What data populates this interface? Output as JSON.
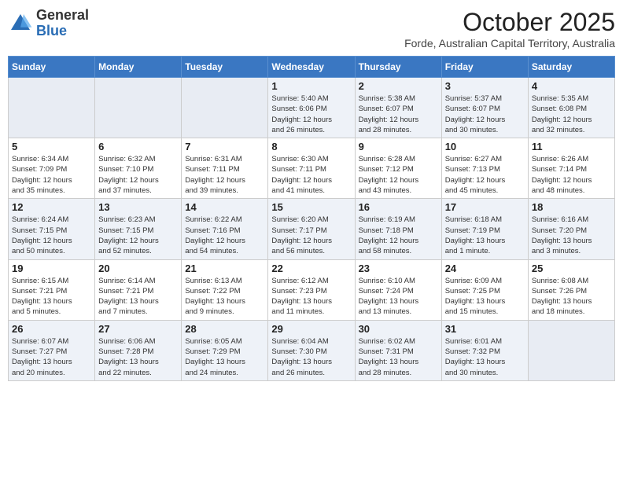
{
  "header": {
    "logo_general": "General",
    "logo_blue": "Blue",
    "month_year": "October 2025",
    "location": "Forde, Australian Capital Territory, Australia"
  },
  "days_of_week": [
    "Sunday",
    "Monday",
    "Tuesday",
    "Wednesday",
    "Thursday",
    "Friday",
    "Saturday"
  ],
  "weeks": [
    [
      {
        "day": "",
        "info": ""
      },
      {
        "day": "",
        "info": ""
      },
      {
        "day": "",
        "info": ""
      },
      {
        "day": "1",
        "info": "Sunrise: 5:40 AM\nSunset: 6:06 PM\nDaylight: 12 hours\nand 26 minutes."
      },
      {
        "day": "2",
        "info": "Sunrise: 5:38 AM\nSunset: 6:07 PM\nDaylight: 12 hours\nand 28 minutes."
      },
      {
        "day": "3",
        "info": "Sunrise: 5:37 AM\nSunset: 6:07 PM\nDaylight: 12 hours\nand 30 minutes."
      },
      {
        "day": "4",
        "info": "Sunrise: 5:35 AM\nSunset: 6:08 PM\nDaylight: 12 hours\nand 32 minutes."
      }
    ],
    [
      {
        "day": "5",
        "info": "Sunrise: 6:34 AM\nSunset: 7:09 PM\nDaylight: 12 hours\nand 35 minutes."
      },
      {
        "day": "6",
        "info": "Sunrise: 6:32 AM\nSunset: 7:10 PM\nDaylight: 12 hours\nand 37 minutes."
      },
      {
        "day": "7",
        "info": "Sunrise: 6:31 AM\nSunset: 7:11 PM\nDaylight: 12 hours\nand 39 minutes."
      },
      {
        "day": "8",
        "info": "Sunrise: 6:30 AM\nSunset: 7:11 PM\nDaylight: 12 hours\nand 41 minutes."
      },
      {
        "day": "9",
        "info": "Sunrise: 6:28 AM\nSunset: 7:12 PM\nDaylight: 12 hours\nand 43 minutes."
      },
      {
        "day": "10",
        "info": "Sunrise: 6:27 AM\nSunset: 7:13 PM\nDaylight: 12 hours\nand 45 minutes."
      },
      {
        "day": "11",
        "info": "Sunrise: 6:26 AM\nSunset: 7:14 PM\nDaylight: 12 hours\nand 48 minutes."
      }
    ],
    [
      {
        "day": "12",
        "info": "Sunrise: 6:24 AM\nSunset: 7:15 PM\nDaylight: 12 hours\nand 50 minutes."
      },
      {
        "day": "13",
        "info": "Sunrise: 6:23 AM\nSunset: 7:15 PM\nDaylight: 12 hours\nand 52 minutes."
      },
      {
        "day": "14",
        "info": "Sunrise: 6:22 AM\nSunset: 7:16 PM\nDaylight: 12 hours\nand 54 minutes."
      },
      {
        "day": "15",
        "info": "Sunrise: 6:20 AM\nSunset: 7:17 PM\nDaylight: 12 hours\nand 56 minutes."
      },
      {
        "day": "16",
        "info": "Sunrise: 6:19 AM\nSunset: 7:18 PM\nDaylight: 12 hours\nand 58 minutes."
      },
      {
        "day": "17",
        "info": "Sunrise: 6:18 AM\nSunset: 7:19 PM\nDaylight: 13 hours\nand 1 minute."
      },
      {
        "day": "18",
        "info": "Sunrise: 6:16 AM\nSunset: 7:20 PM\nDaylight: 13 hours\nand 3 minutes."
      }
    ],
    [
      {
        "day": "19",
        "info": "Sunrise: 6:15 AM\nSunset: 7:21 PM\nDaylight: 13 hours\nand 5 minutes."
      },
      {
        "day": "20",
        "info": "Sunrise: 6:14 AM\nSunset: 7:21 PM\nDaylight: 13 hours\nand 7 minutes."
      },
      {
        "day": "21",
        "info": "Sunrise: 6:13 AM\nSunset: 7:22 PM\nDaylight: 13 hours\nand 9 minutes."
      },
      {
        "day": "22",
        "info": "Sunrise: 6:12 AM\nSunset: 7:23 PM\nDaylight: 13 hours\nand 11 minutes."
      },
      {
        "day": "23",
        "info": "Sunrise: 6:10 AM\nSunset: 7:24 PM\nDaylight: 13 hours\nand 13 minutes."
      },
      {
        "day": "24",
        "info": "Sunrise: 6:09 AM\nSunset: 7:25 PM\nDaylight: 13 hours\nand 15 minutes."
      },
      {
        "day": "25",
        "info": "Sunrise: 6:08 AM\nSunset: 7:26 PM\nDaylight: 13 hours\nand 18 minutes."
      }
    ],
    [
      {
        "day": "26",
        "info": "Sunrise: 6:07 AM\nSunset: 7:27 PM\nDaylight: 13 hours\nand 20 minutes."
      },
      {
        "day": "27",
        "info": "Sunrise: 6:06 AM\nSunset: 7:28 PM\nDaylight: 13 hours\nand 22 minutes."
      },
      {
        "day": "28",
        "info": "Sunrise: 6:05 AM\nSunset: 7:29 PM\nDaylight: 13 hours\nand 24 minutes."
      },
      {
        "day": "29",
        "info": "Sunrise: 6:04 AM\nSunset: 7:30 PM\nDaylight: 13 hours\nand 26 minutes."
      },
      {
        "day": "30",
        "info": "Sunrise: 6:02 AM\nSunset: 7:31 PM\nDaylight: 13 hours\nand 28 minutes."
      },
      {
        "day": "31",
        "info": "Sunrise: 6:01 AM\nSunset: 7:32 PM\nDaylight: 13 hours\nand 30 minutes."
      },
      {
        "day": "",
        "info": ""
      }
    ]
  ]
}
